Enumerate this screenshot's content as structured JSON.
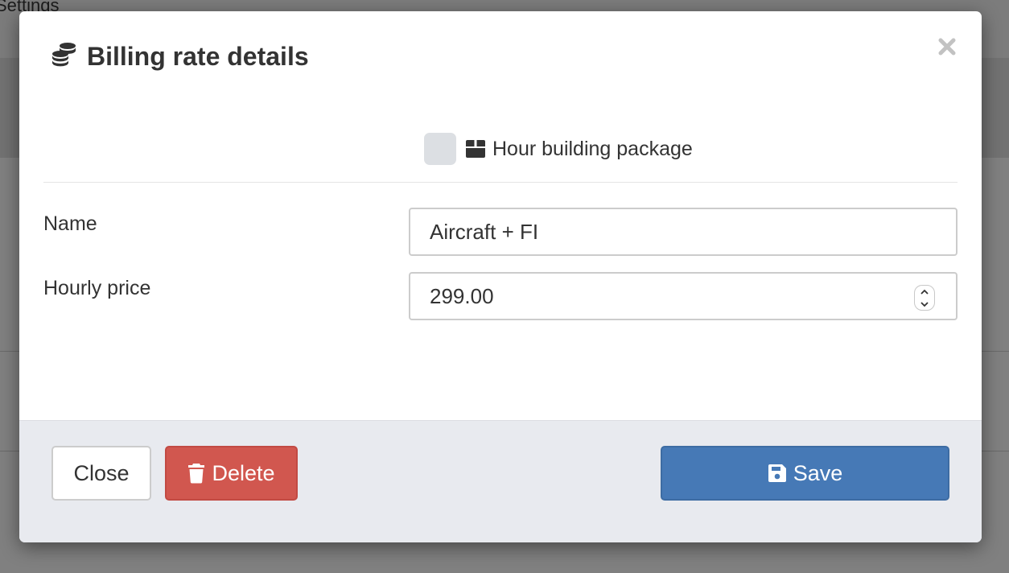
{
  "background": {
    "title": "Settings"
  },
  "modal": {
    "title": "Billing rate details",
    "title_icon": "coins-icon",
    "close_glyph": "×"
  },
  "package": {
    "label": "Hour building package",
    "checked": false,
    "icon": "box-icon"
  },
  "form": {
    "name": {
      "label": "Name",
      "value": "Aircraft + FI"
    },
    "hourly_price": {
      "label": "Hourly price",
      "value": "299.00"
    }
  },
  "footer": {
    "close_label": "Close",
    "delete_label": "Delete",
    "save_label": "Save"
  },
  "colors": {
    "delete": "#d1574f",
    "save": "#4679b6",
    "footer_bg": "#e8eaef"
  }
}
